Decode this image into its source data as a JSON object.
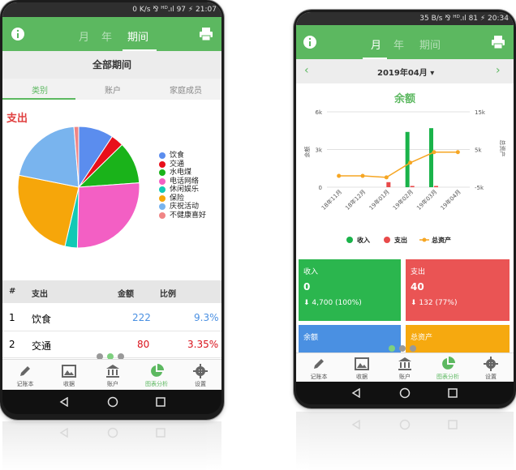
{
  "left_phone": {
    "status_text": "0 K/s ⅋ ᴴᴰ.ıl 97 ⚡ 21:07",
    "tabs": [
      "月",
      "年",
      "期间"
    ],
    "active_tab": 2,
    "period_title": "全部期间",
    "sub_tabs": [
      "类别",
      "账户",
      "家庭成员"
    ],
    "expense_label": "支出",
    "legend": [
      {
        "label": "饮食",
        "color": "#5b8dee"
      },
      {
        "label": "交通",
        "color": "#e8101b"
      },
      {
        "label": "水电煤",
        "color": "#1ab31a"
      },
      {
        "label": "电话网络",
        "color": "#f35fc4"
      },
      {
        "label": "休闲娱乐",
        "color": "#12c9b5"
      },
      {
        "label": "保险",
        "color": "#f6a60a"
      },
      {
        "label": "庆祝活动",
        "color": "#79b4ee"
      },
      {
        "label": "不健康喜好",
        "color": "#f08585"
      }
    ],
    "pie_values": [
      9.3,
      3.35,
      11.2,
      26.5,
      3.3,
      24.5,
      20.6,
      1.25
    ],
    "table": {
      "headers": [
        "#",
        "支出",
        "金额",
        "比例"
      ],
      "rows": [
        {
          "index": "1",
          "name": "饮食",
          "amount": "222",
          "ratio": "9.3%"
        },
        {
          "index": "2",
          "name": "交通",
          "amount": "80",
          "ratio": "3.35%"
        }
      ]
    },
    "nav": [
      "记账本",
      "收据",
      "账户",
      "图表分析",
      "设置"
    ],
    "active_nav": 3
  },
  "right_phone": {
    "status_text": "35 B/s ⅋ ᴴᴰ.ıl 81 ⚡ 20:34",
    "tabs": [
      "月",
      "年",
      "期间"
    ],
    "active_tab": 0,
    "month_label": "2019年04月",
    "chart_title": "余额",
    "chart_data": {
      "type": "bar",
      "categories": [
        "18年11月",
        "18年12月",
        "19年01月",
        "19年02月",
        "19年03月",
        "19年04月"
      ],
      "series": [
        {
          "name": "收入",
          "color": "#1ab34a",
          "values": [
            0,
            0,
            0,
            4400,
            4700,
            0
          ]
        },
        {
          "name": "支出",
          "color": "#e84a4a",
          "values": [
            0,
            0,
            400,
            100,
            100,
            0
          ]
        }
      ],
      "line_series": {
        "name": "总资产",
        "color": "#f6a623",
        "values": [
          -2000,
          -2000,
          -2400,
          1500,
          4300,
          4300
        ]
      },
      "ylabel": "余额",
      "y2label": "总资产",
      "yticks_left": [
        "6k",
        "3k",
        "0"
      ],
      "yticks_right": [
        "15k",
        "5k",
        "-5k"
      ],
      "ylim": [
        0,
        6000
      ],
      "y2lim": [
        -5000,
        15000
      ],
      "legend_position": "bottom"
    },
    "cards": [
      {
        "title": "收入",
        "value": "0",
        "sub": "⬇ 4,700 (100%)",
        "color": "#2bb64e"
      },
      {
        "title": "支出",
        "value": "40",
        "sub": "⬇ 132 (77%)",
        "color": "#ea5454"
      },
      {
        "title": "余额",
        "color": "#4a90e2"
      },
      {
        "title": "总资产",
        "color": "#f6a90f"
      }
    ],
    "nav": [
      "记账本",
      "收据",
      "账户",
      "图表分析",
      "设置"
    ],
    "active_nav": 3
  }
}
